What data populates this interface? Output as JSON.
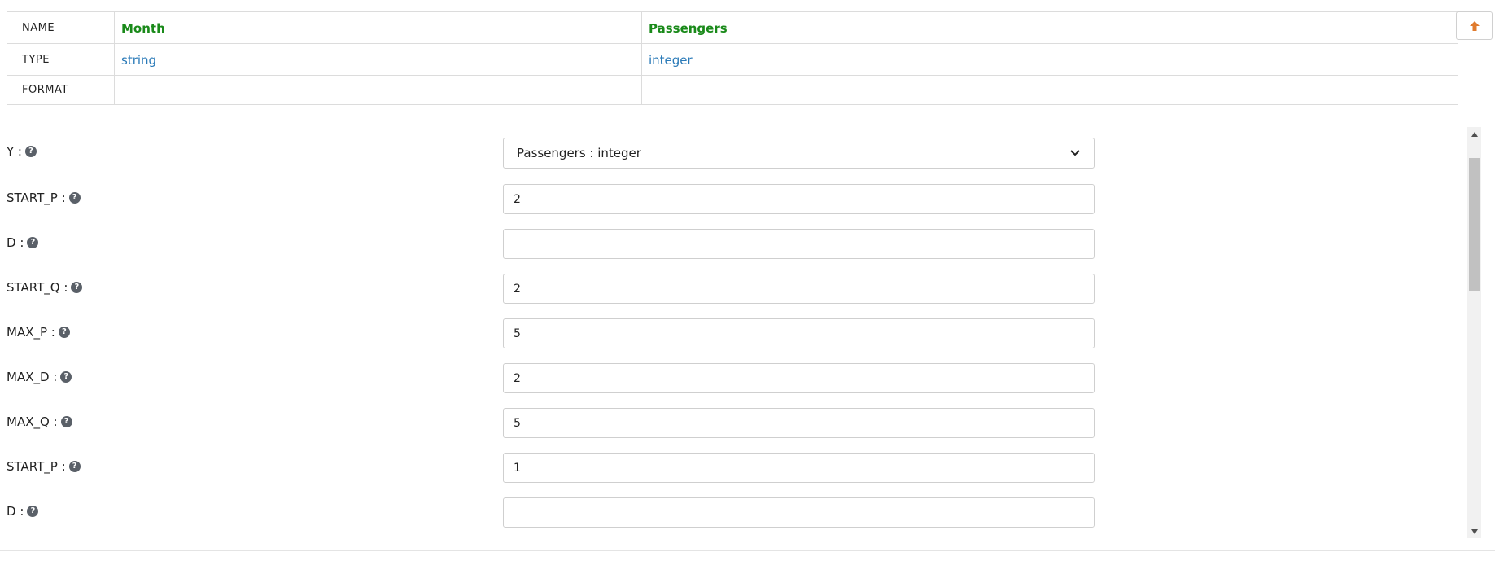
{
  "schema": {
    "row_headers": [
      "NAME",
      "TYPE",
      "FORMAT"
    ],
    "columns": [
      {
        "name": "Month",
        "type": "string",
        "format": ""
      },
      {
        "name": "Passengers",
        "type": "integer",
        "format": ""
      }
    ],
    "colors": {
      "name": "#1a8a1a",
      "type": "#2a7ab8"
    }
  },
  "toolbar": {
    "scroll_top_icon": "arrow-up-icon",
    "accent": "#e07b2e"
  },
  "form": {
    "fields": [
      {
        "label": "Y :",
        "kind": "select",
        "value": "Passengers : integer"
      },
      {
        "label": "START_P :",
        "kind": "input",
        "value": "2"
      },
      {
        "label": "D :",
        "kind": "input",
        "value": ""
      },
      {
        "label": "START_Q :",
        "kind": "input",
        "value": "2"
      },
      {
        "label": "MAX_P :",
        "kind": "input",
        "value": "5"
      },
      {
        "label": "MAX_D :",
        "kind": "input",
        "value": "2"
      },
      {
        "label": "MAX_Q :",
        "kind": "input",
        "value": "5"
      },
      {
        "label": "START_P :",
        "kind": "input",
        "value": "1"
      },
      {
        "label": "D :",
        "kind": "input",
        "value": ""
      }
    ],
    "help_icon": "question-circle-icon"
  }
}
